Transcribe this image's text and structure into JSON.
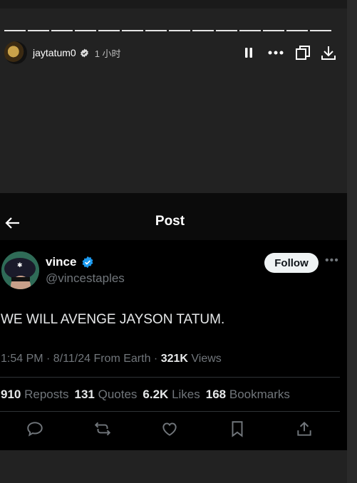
{
  "story": {
    "segments": 14,
    "username": "jaytatum0",
    "time": "1 小时"
  },
  "post": {
    "title": "Post",
    "display_name": "vince",
    "handle": "@vincestaples",
    "follow_label": "Follow",
    "text": "WE WILL AVENGE JAYSON TATUM.",
    "timestamp": "1:54 PM · 8/11/24 From Earth · ",
    "views_count": "321K",
    "views_label": " Views",
    "reposts_count": "910",
    "reposts_label": "Reposts",
    "quotes_count": "131",
    "quotes_label": "Quotes",
    "likes_count": "6.2K",
    "likes_label": "Likes",
    "bookmarks_count": "168",
    "bookmarks_label": "Bookmarks"
  },
  "colors": {
    "verified_blue": "#1d9bf0",
    "secondary_text": "#71767b"
  }
}
